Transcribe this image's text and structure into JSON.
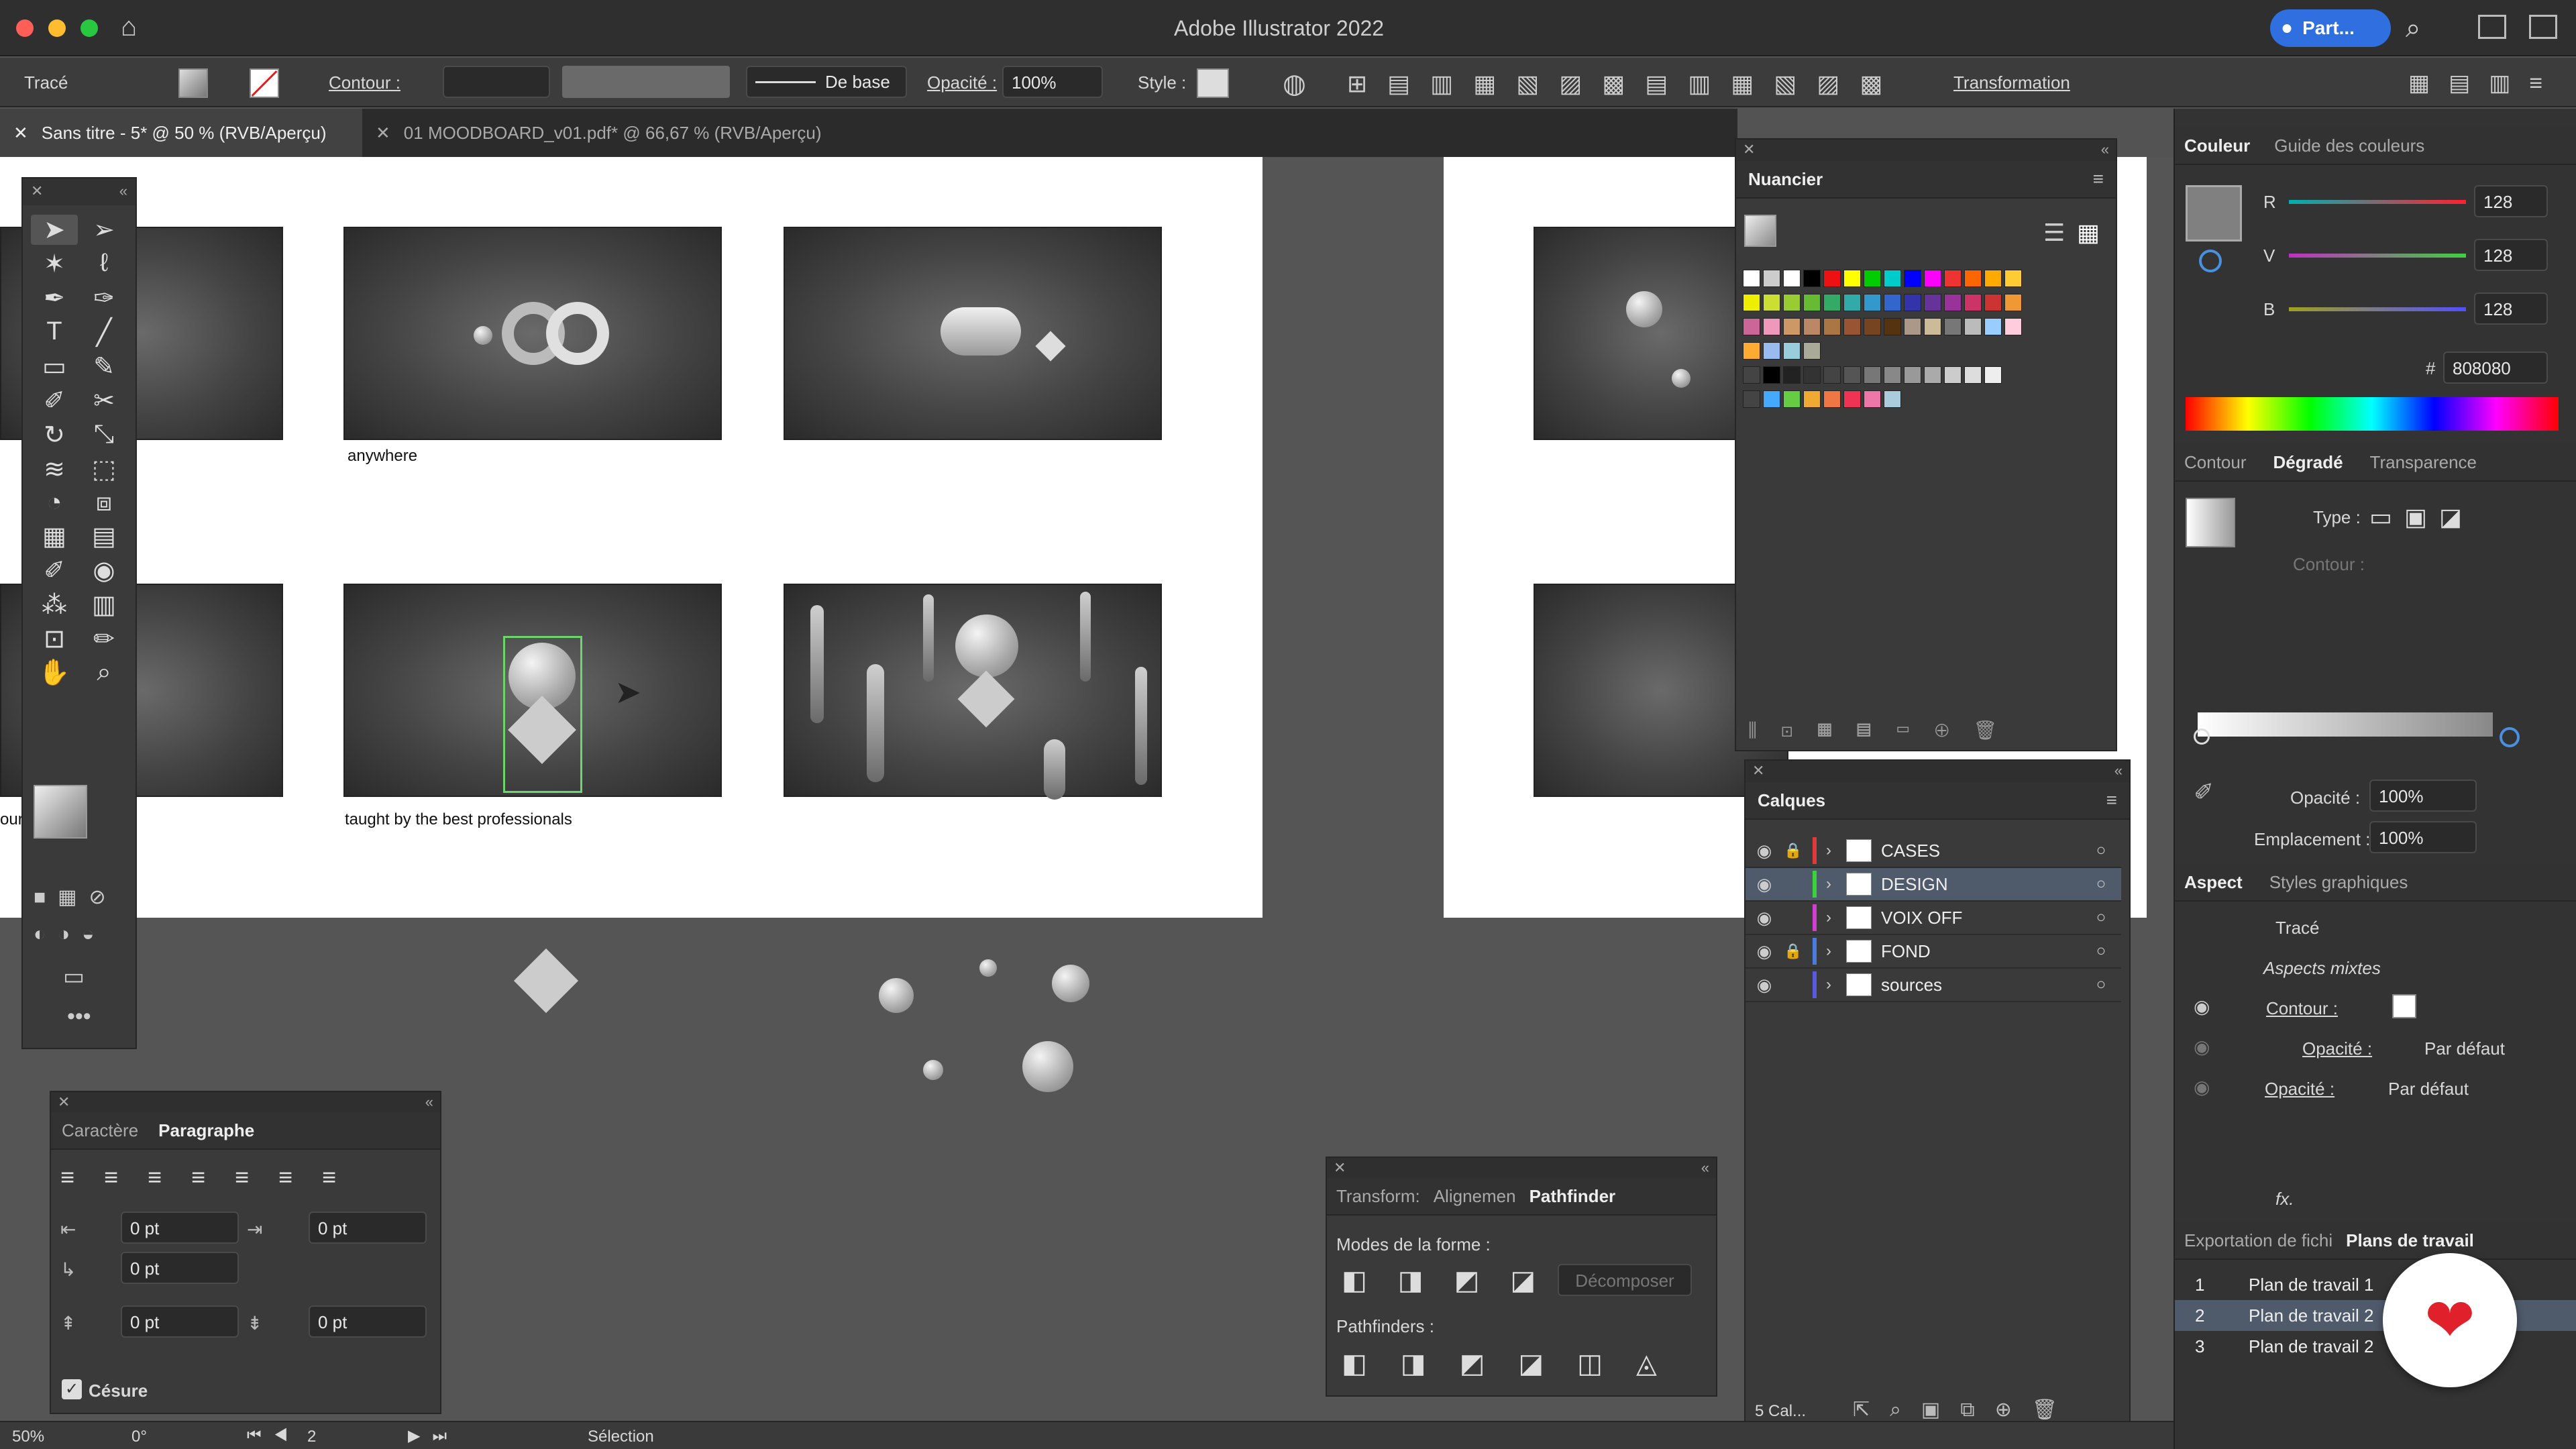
{
  "window": {
    "title": "Adobe Illustrator 2022",
    "share_label": "Part..."
  },
  "controlbar": {
    "object_type": "Tracé",
    "contour_label": "Contour :",
    "brush_label": "De base",
    "opacity_label": "Opacité :",
    "opacity_value": "100%",
    "style_label": "Style :",
    "transform_label": "Transformation"
  },
  "tabs": [
    {
      "label": "Sans titre - 5* @ 50 % (RVB/Aperçu)",
      "active": true
    },
    {
      "label": "01 MOODBOARD_v01.pdf* @ 66,67 % (RVB/Aperçu)",
      "active": false
    }
  ],
  "artboard": {
    "caption_1": "anywhere",
    "caption_2": "taught by the best professionals",
    "edge_text": "our"
  },
  "swatches_panel": {
    "title": "Nuancier"
  },
  "color_panel": {
    "tab_active": "Couleur",
    "tab_other": "Guide des couleurs",
    "r_label": "R",
    "r_value": "128",
    "v_label": "V",
    "v_value": "128",
    "b_label": "B",
    "b_value": "128",
    "hex_label": "#",
    "hex_value": "808080"
  },
  "gradient_panel": {
    "tab_contour": "Contour",
    "tab_active": "Dégradé",
    "tab_transparency": "Transparence",
    "type_label": "Type :",
    "contour_label": "Contour :",
    "opacity_label": "Opacité :",
    "opacity_value": "100%",
    "location_label": "Emplacement :",
    "location_value": "100%"
  },
  "layers_panel": {
    "title": "Calques",
    "layers": [
      {
        "name": "CASES",
        "color": "#e03a3a",
        "locked": true,
        "selected": false
      },
      {
        "name": "DESIGN",
        "color": "#3ad23a",
        "locked": false,
        "selected": true
      },
      {
        "name": "VOIX OFF",
        "color": "#d040d0",
        "locked": false,
        "selected": false
      },
      {
        "name": "FOND",
        "color": "#4a7ce0",
        "locked": true,
        "selected": false
      },
      {
        "name": "sources",
        "color": "#5a5ae0",
        "locked": false,
        "selected": false
      }
    ],
    "count_label": "5 Cal..."
  },
  "appearance_panel": {
    "tab_active": "Aspect",
    "tab_other": "Styles graphiques",
    "object": "Tracé",
    "mixed": "Aspects mixtes",
    "contour_label": "Contour :",
    "opacity_label_1": "Opacité :",
    "opacity_value_1": "Par défaut",
    "opacity_label_2": "Opacité :",
    "opacity_value_2": "Par défaut",
    "fx_label": "fx."
  },
  "artboards_panel": {
    "tab_other": "Exportation de fichi",
    "tab_active": "Plans de travail",
    "boards": [
      {
        "num": "1",
        "name": "Plan de travail 1"
      },
      {
        "num": "2",
        "name": "Plan de travail 2"
      },
      {
        "num": "3",
        "name": "Plan de travail 2"
      }
    ]
  },
  "paragraph_panel": {
    "tab_other": "Caractère",
    "tab_active": "Paragraphe",
    "indent_left": "0 pt",
    "indent_right": "0 pt",
    "indent_first": "0 pt",
    "space_before": "0 pt",
    "space_after": "0 pt",
    "hyphen_label": "Césure"
  },
  "pathfinder_panel": {
    "tab_1": "Transform:",
    "tab_2": "Alignemen",
    "tab_active": "Pathfinder",
    "shape_modes_label": "Modes de la forme :",
    "expand_label": "Décomposer",
    "pathfinders_label": "Pathfinders :"
  },
  "statusbar": {
    "zoom": "50%",
    "rotation": "0°",
    "artboard_num": "2",
    "tool": "Sélection"
  }
}
